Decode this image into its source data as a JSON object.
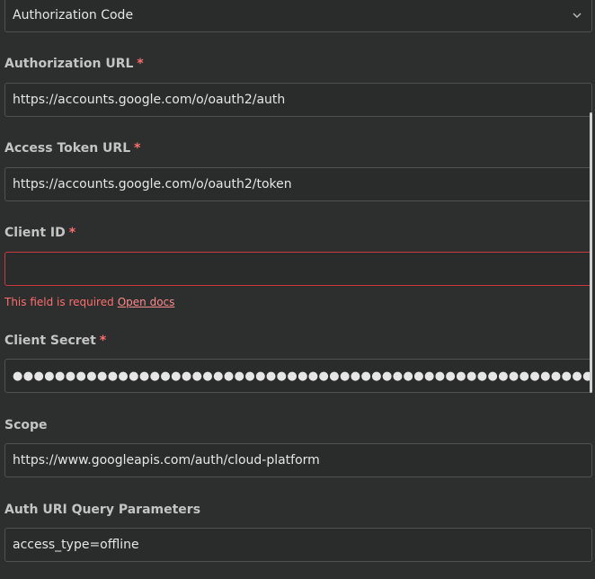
{
  "grant_type": {
    "value": "Authorization Code"
  },
  "authorization_url": {
    "label": "Authorization URL",
    "required": "*",
    "value": "https://accounts.google.com/o/oauth2/auth"
  },
  "access_token_url": {
    "label": "Access Token URL",
    "required": "*",
    "value": "https://accounts.google.com/o/oauth2/token"
  },
  "client_id": {
    "label": "Client ID",
    "required": "*",
    "value": "",
    "error_text": "This field is required",
    "error_link": "Open docs"
  },
  "client_secret": {
    "label": "Client Secret",
    "required": "*",
    "value": "●●●●●●●●●●●●●●●●●●●●●●●●●●●●●●●●●●●●●●●●●●●●●●●●●●●●●●●●●●●"
  },
  "scope": {
    "label": "Scope",
    "value": "https://www.googleapis.com/auth/cloud-platform"
  },
  "auth_uri_query_parameters": {
    "label": "Auth URI Query Parameters",
    "value": "access_type=offline"
  }
}
